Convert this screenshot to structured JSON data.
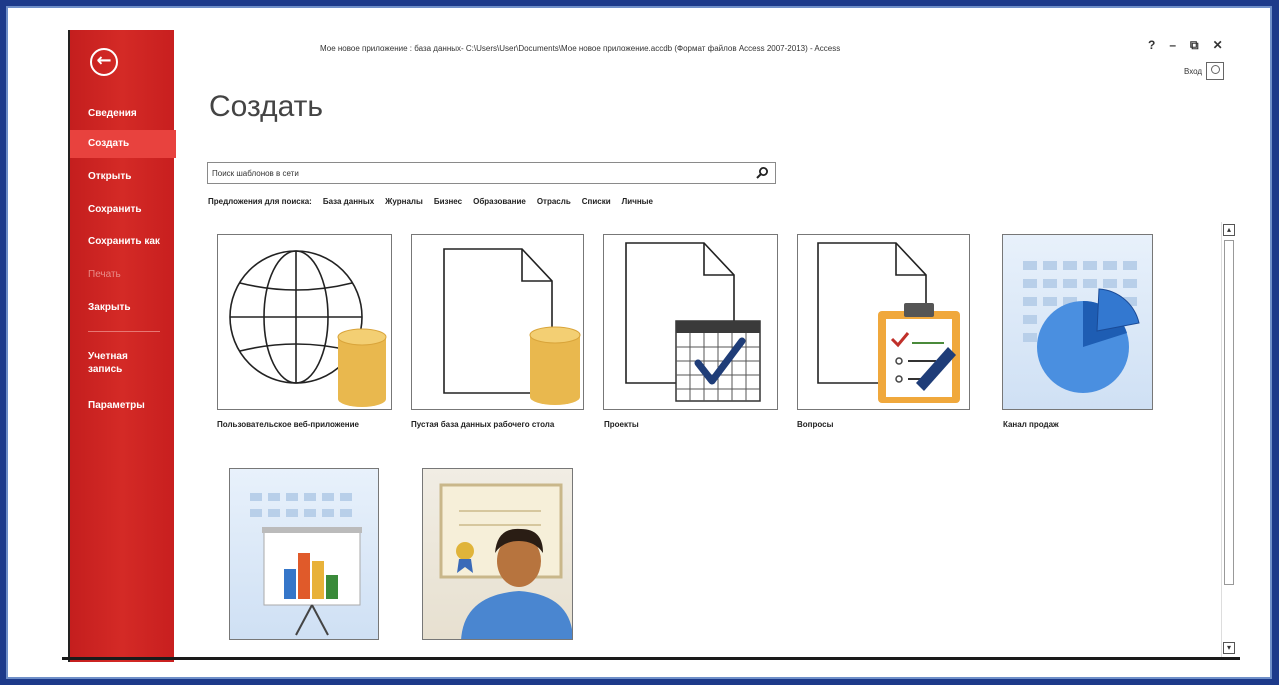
{
  "window": {
    "title": "Мое новое приложение : база данных- C:\\Users\\User\\Documents\\Мое новое приложение.accdb (Формат файлов Access 2007-2013) - Access",
    "controls": [
      "?",
      "–",
      "⧉",
      "✕"
    ],
    "user": "Вход"
  },
  "sidebar": {
    "back_glyph": "←",
    "items": [
      {
        "label": "Сведения",
        "state": "normal"
      },
      {
        "label": "Создать",
        "state": "active"
      },
      {
        "label": "Открыть",
        "state": "normal"
      },
      {
        "label": "Сохранить",
        "state": "normal"
      },
      {
        "label": "Сохранить как",
        "state": "normal"
      },
      {
        "label": "Печать",
        "state": "disabled"
      },
      {
        "label": "Закрыть",
        "state": "normal"
      },
      {
        "label": "Учетная запись",
        "state": "normal"
      },
      {
        "label": "Параметры",
        "state": "normal"
      }
    ],
    "accent": "#c41e1e",
    "active_color": "#e8423e"
  },
  "main": {
    "heading": "Создать",
    "search": {
      "placeholder": "Поиск шаблонов в сети",
      "value": "Поиск шаблонов в сети",
      "icon": "search-icon"
    },
    "suggestions_label": "Предложения для поиска:",
    "suggestions": [
      "База данных",
      "Журналы",
      "Бизнес",
      "Образование",
      "Отрасль",
      "Списки",
      "Личные"
    ],
    "templates": [
      {
        "caption": "Пользовательское веб-приложение",
        "icon": "globe-database-icon"
      },
      {
        "caption": "Пустая база данных рабочего стола",
        "icon": "blank-document-database-icon"
      },
      {
        "caption": "Проекты",
        "icon": "calendar-check-icon"
      },
      {
        "caption": "Вопросы",
        "icon": "clipboard-checklist-icon"
      },
      {
        "caption": "Канал продаж",
        "icon": "pie-chart-icon"
      },
      {
        "caption": "",
        "icon": "presentation-chart-icon"
      },
      {
        "caption": "",
        "icon": "certificate-person-icon"
      }
    ]
  }
}
